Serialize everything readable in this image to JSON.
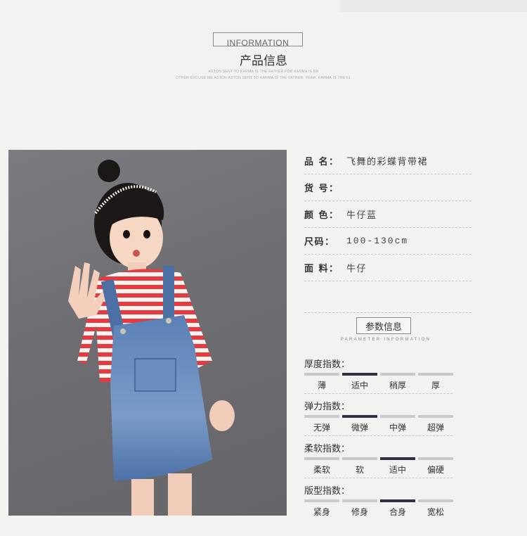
{
  "header": {
    "en_title": "INFORMATION",
    "cn_title": "产品信息",
    "tagline_1": "ASTON SENT TO KARMA IS THE FATHER FOR KARMA IS BR",
    "tagline_2": "OTHER EXCUSE ME ASTON ASTON SENT TO KARMA IS THE FATHER. YEAH, KARMA IS THE EL"
  },
  "specs": [
    {
      "label": "品 名：",
      "value": "飞舞的彩蝶背带裙"
    },
    {
      "label": "货 号：",
      "value": ""
    },
    {
      "label": "颜 色：",
      "value": "牛仔蓝"
    },
    {
      "label": "尺码：",
      "value": "100-130cm"
    },
    {
      "label": "面 料：",
      "value": "牛仔"
    }
  ],
  "param": {
    "title": "参数信息",
    "subtitle": "PARAMETER INFORMATION"
  },
  "indices": [
    {
      "title": "厚度指数：",
      "options": [
        "薄",
        "适中",
        "稍厚",
        "厚"
      ],
      "selected": 1
    },
    {
      "title": "弹力指数：",
      "options": [
        "无弹",
        "微弹",
        "中弹",
        "超弹"
      ],
      "selected": 1
    },
    {
      "title": "柔软指数：",
      "options": [
        "柔软",
        "软",
        "适中",
        "偏硬"
      ],
      "selected": 2
    },
    {
      "title": "版型指数：",
      "options": [
        "紧身",
        "修身",
        "合身",
        "宽松"
      ],
      "selected": 2
    }
  ],
  "colors": {
    "selected_bar": "#2f3142",
    "bar": "#c9c9c9"
  }
}
